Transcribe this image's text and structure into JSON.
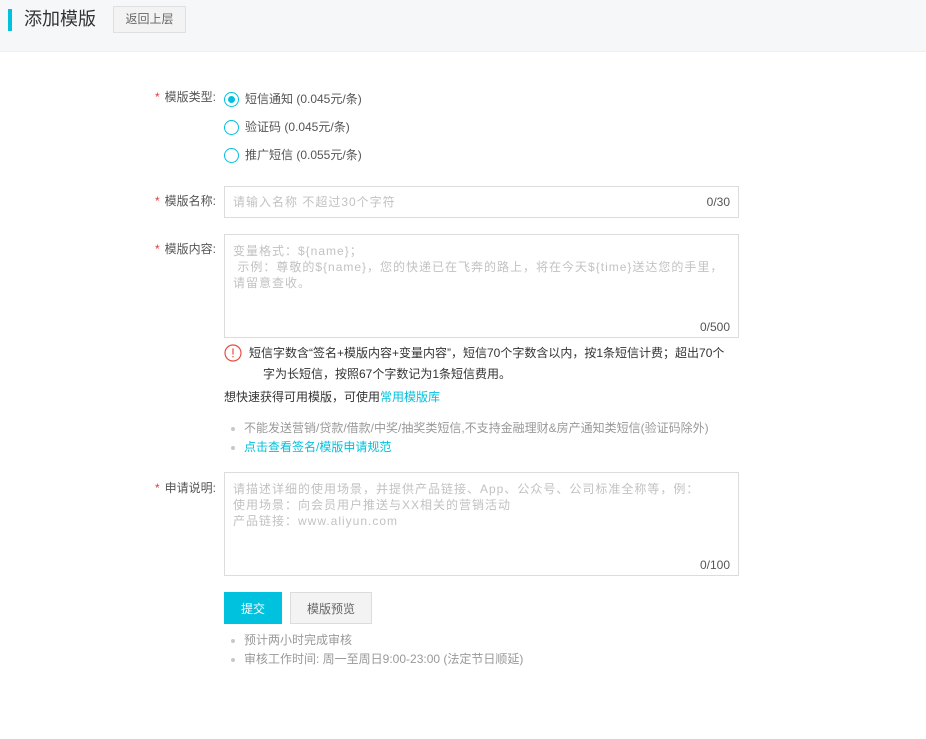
{
  "header": {
    "title": "添加模版",
    "back_label": "返回上层"
  },
  "colors": {
    "accent": "#00c1de",
    "required": "#e4393c",
    "warning": "#e84c3d"
  },
  "form": {
    "required_mark": "*",
    "template_type": {
      "label": "模版类型:",
      "options": [
        {
          "label": "短信通知 (0.045元/条)",
          "selected": true
        },
        {
          "label": "验证码 (0.045元/条)",
          "selected": false
        },
        {
          "label": "推广短信 (0.055元/条)",
          "selected": false
        }
      ]
    },
    "template_name": {
      "label": "模版名称:",
      "placeholder": "请输入名称 不超过30个字符",
      "value": "",
      "counter": "0/30"
    },
    "template_content": {
      "label": "模版内容:",
      "placeholder": "变量格式：${name}；\n 示例：尊敬的${name}，您的快递已在飞奔的路上，将在今天${time}送达您的手里，\n请留意查收。",
      "value": "",
      "counter": "0/500"
    },
    "length_note": {
      "icon": "exclamation-circle-icon",
      "lines": [
        "短信字数含“签名+模版内容+变量内容”，短信70个字数含以内，按1条短信计费；超出70个",
        "字为长短信，按照67个字数记为1条短信费用。"
      ]
    },
    "quick_template": {
      "text": "想快速获得可用模版，可使用",
      "link_label": "常用模版库"
    },
    "rules_tips": {
      "text": "不能发送营销/贷款/借款/中奖/抽奖类短信,不支持金融理财&房产通知类短信(验证码除外)",
      "link_label": "点击查看签名/模版申请规范"
    },
    "description": {
      "label": "申请说明:",
      "placeholder": "请描述详细的使用场景，并提供产品链接、App、公众号、公司标准全称等，例：\n使用场景：向会员用户推送与XX相关的营销活动\n产品链接：www.aliyun.com",
      "value": "",
      "counter": "0/100"
    },
    "actions": {
      "submit_label": "提交",
      "preview_label": "模版预览"
    },
    "review_tips": [
      "预计两小时完成审核",
      "审核工作时间: 周一至周日9:00-23:00 (法定节日顺延)"
    ]
  }
}
